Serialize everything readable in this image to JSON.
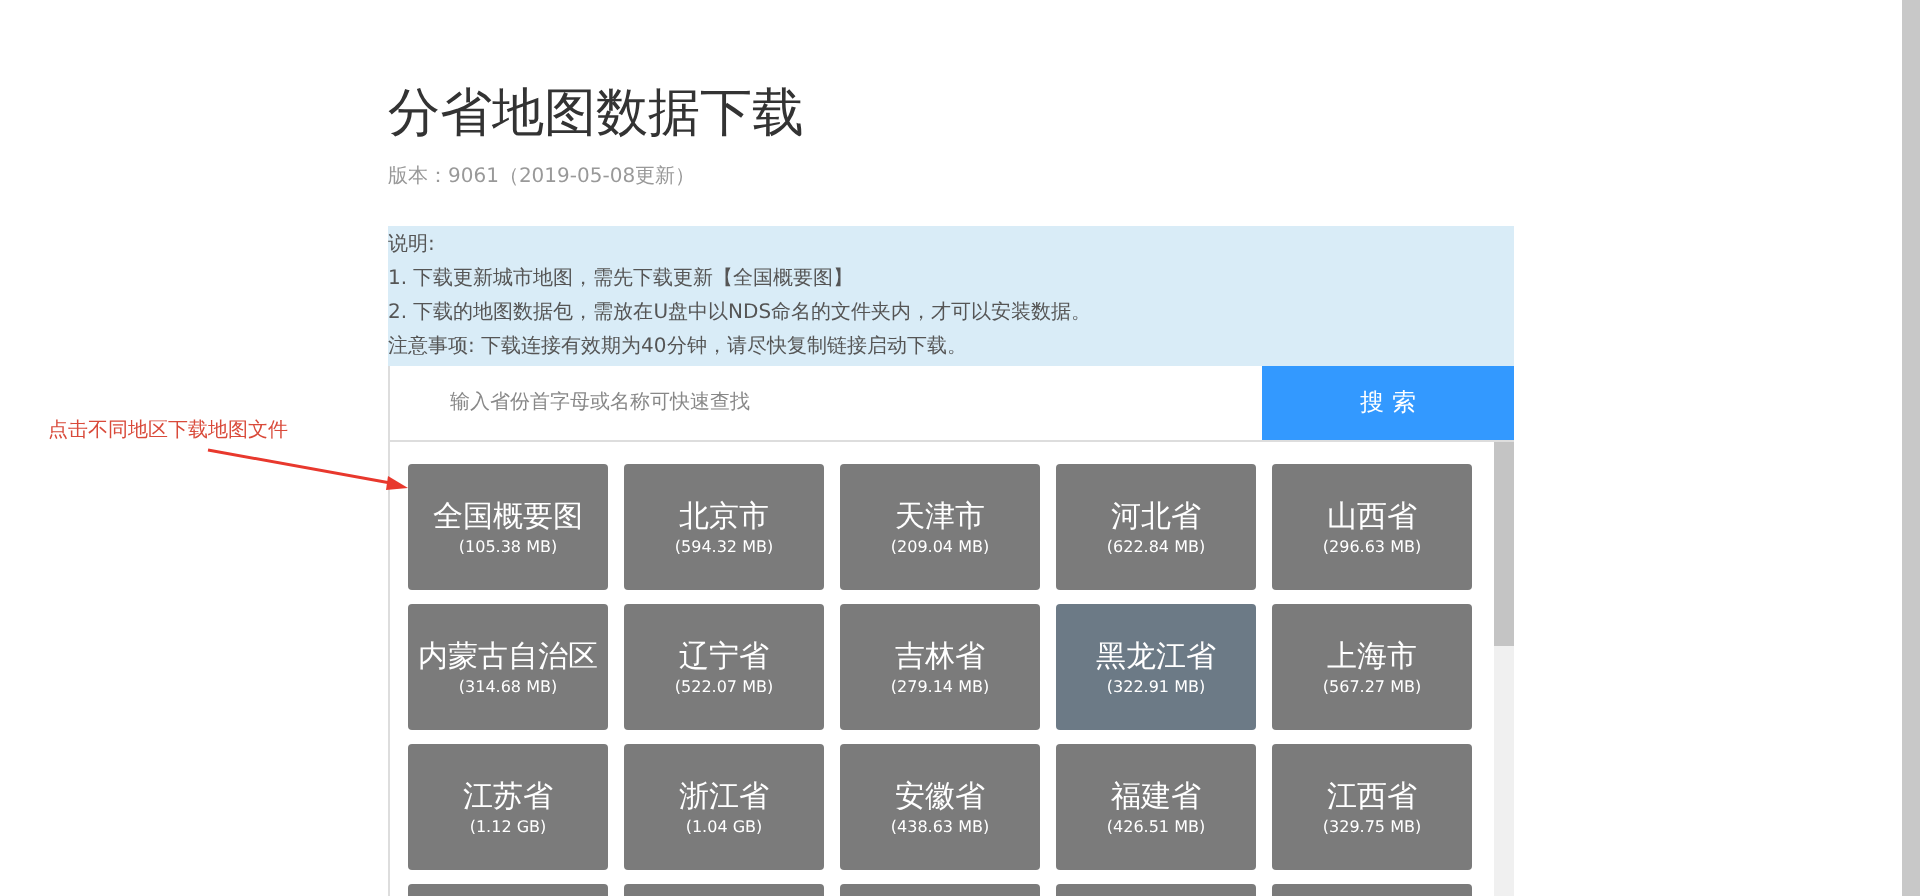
{
  "title": "分省地图数据下载",
  "version": "版本：9061（2019-05-08更新）",
  "notes": [
    "说明:",
    "1. 下载更新城市地图，需先下载更新【全国概要图】",
    "2. 下载的地图数据包，需放在U盘中以NDS命名的文件夹内，才可以安装数据。",
    "注意事项: 下载连接有效期为40分钟，请尽快复制链接启动下载。"
  ],
  "search": {
    "placeholder": "输入省份首字母或名称可快速查找",
    "button": "搜 索"
  },
  "annotation": "点击不同地区下载地图文件",
  "tiles": [
    {
      "kind": "region",
      "name": "全国概要图",
      "size": "(105.38 MB)",
      "selected": false
    },
    {
      "kind": "region",
      "name": "北京市",
      "size": "(594.32 MB)",
      "selected": false
    },
    {
      "kind": "region",
      "name": "天津市",
      "size": "(209.04 MB)",
      "selected": false
    },
    {
      "kind": "region",
      "name": "河北省",
      "size": "(622.84 MB)",
      "selected": false
    },
    {
      "kind": "region",
      "name": "山西省",
      "size": "(296.63 MB)",
      "selected": false
    },
    {
      "kind": "region",
      "name": "内蒙古自治区",
      "size": "(314.68 MB)",
      "selected": false
    },
    {
      "kind": "region",
      "name": "辽宁省",
      "size": "(522.07 MB)",
      "selected": false
    },
    {
      "kind": "region",
      "name": "吉林省",
      "size": "(279.14 MB)",
      "selected": false
    },
    {
      "kind": "region",
      "name": "黑龙江省",
      "size": "(322.91 MB)",
      "selected": true
    },
    {
      "kind": "region",
      "name": "上海市",
      "size": "(567.27 MB)",
      "selected": false
    },
    {
      "kind": "region",
      "name": "江苏省",
      "size": "(1.12 GB)",
      "selected": false
    },
    {
      "kind": "region",
      "name": "浙江省",
      "size": "(1.04 GB)",
      "selected": false
    },
    {
      "kind": "region",
      "name": "安徽省",
      "size": "(438.63 MB)",
      "selected": false
    },
    {
      "kind": "region",
      "name": "福建省",
      "size": "(426.51 MB)",
      "selected": false
    },
    {
      "kind": "region",
      "name": "江西省",
      "size": "(329.75 MB)",
      "selected": false
    },
    {
      "kind": "cut"
    },
    {
      "kind": "cut"
    },
    {
      "kind": "cut"
    },
    {
      "kind": "cut"
    },
    {
      "kind": "cut"
    }
  ]
}
